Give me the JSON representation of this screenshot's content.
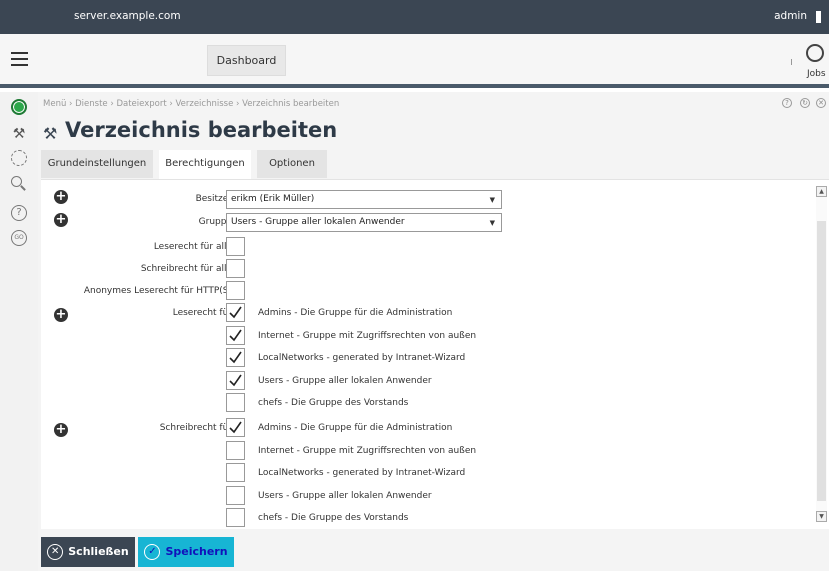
{
  "topbar": {
    "host": "server.example.com",
    "user": "admin"
  },
  "navbar": {
    "dashboard": "Dashboard",
    "jobs": "Jobs"
  },
  "breadcrumb": "Menü › Dienste › Dateiexport › Verzeichnisse › Verzeichnis bearbeiten",
  "page": {
    "title": "Verzeichnis bearbeiten"
  },
  "tabs": [
    "Grundeinstellungen",
    "Berechtigungen",
    "Optionen"
  ],
  "active_tab": "Berechtigungen",
  "form": {
    "owner_label": "Besitzer",
    "owner_value": "erikm (Erik Müller)",
    "group_label": "Gruppe",
    "group_value": "Users - Gruppe aller lokalen Anwender",
    "read_all_label": "Leserecht für alle",
    "write_all_label": "Schreibrecht für alle",
    "anon_read_label": "Anonymes Leserecht für HTTP(S)",
    "read_for_label": "Leserecht für",
    "write_for_label": "Schreibrecht für"
  },
  "read_groups": [
    {
      "label": "Admins - Die Gruppe für die Administration",
      "checked": true
    },
    {
      "label": "Internet - Gruppe mit Zugriffsrechten von außen",
      "checked": true
    },
    {
      "label": "LocalNetworks - generated by Intranet-Wizard",
      "checked": true
    },
    {
      "label": "Users - Gruppe aller lokalen Anwender",
      "checked": true
    },
    {
      "label": "chefs - Die Gruppe des Vorstands",
      "checked": false
    }
  ],
  "write_groups": [
    {
      "label": "Admins - Die Gruppe für die Administration",
      "checked": true
    },
    {
      "label": "Internet - Gruppe mit Zugriffsrechten von außen",
      "checked": false
    },
    {
      "label": "LocalNetworks - generated by Intranet-Wizard",
      "checked": false
    },
    {
      "label": "Users - Gruppe aller lokalen Anwender",
      "checked": false
    },
    {
      "label": "chefs - Die Gruppe des Vorstands",
      "checked": false
    }
  ],
  "footer": {
    "close": "Schließen",
    "save": "Speichern"
  },
  "colors": {
    "topbar": "#3b4653",
    "save": "#17b5d4",
    "status_ok": "#2ca84a"
  }
}
